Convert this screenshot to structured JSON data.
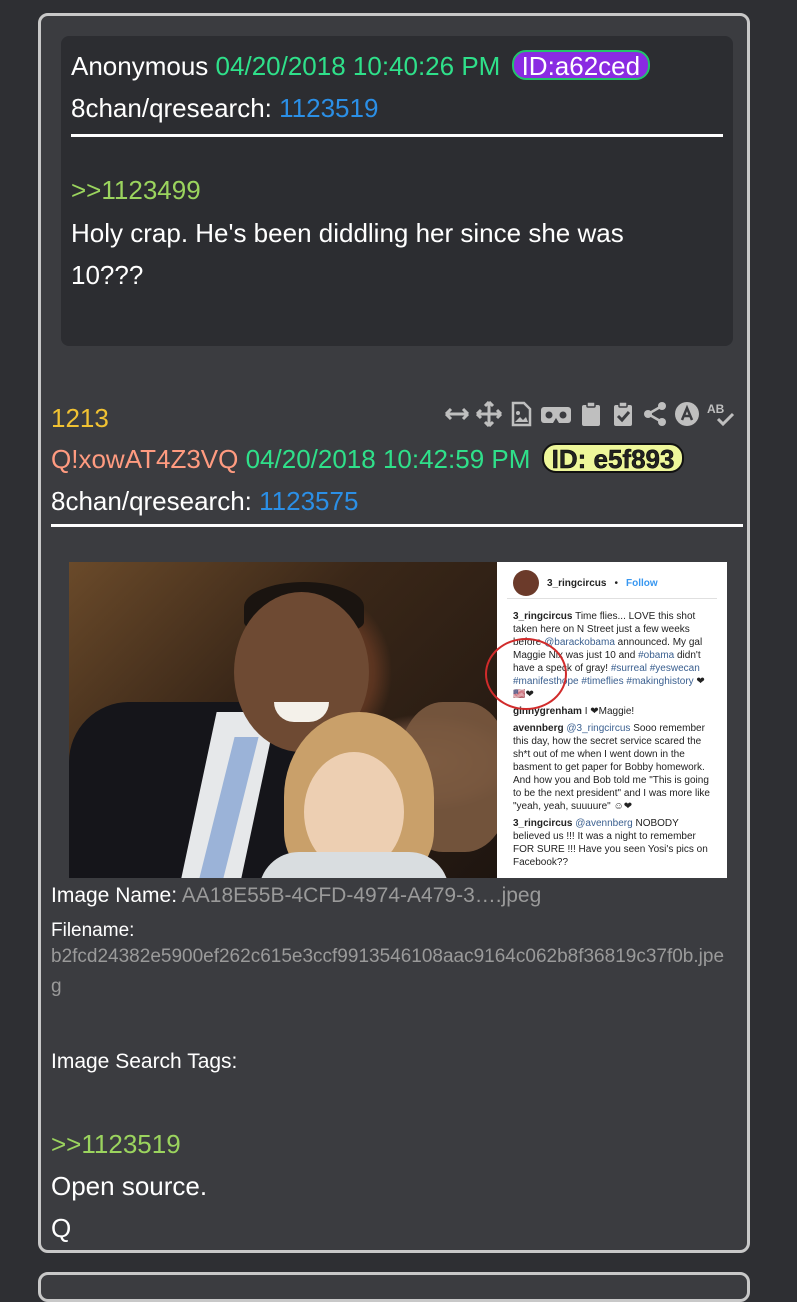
{
  "post1": {
    "author": "Anonymous",
    "datetime": "04/20/2018 10:40:26 PM",
    "id_badge": "ID:a62ced",
    "board": "8chan/qresearch:",
    "post_number": "1123519",
    "reply_link": ">>1123499",
    "body_line1": "Holy crap. He's been diddling her since she was",
    "body_line2": "10???"
  },
  "post2": {
    "index": "1213",
    "tripcode_prefix": "Q",
    "tripcode": "!xowAT4Z3VQ",
    "datetime": "04/20/2018 10:42:59 PM",
    "id_badge": "ID: e5f893",
    "board": "8chan/qresearch:",
    "post_number": "1123575",
    "image_name_label": "Image Name:",
    "image_name": "AA18E55B-4CFD-4974-A479-3….jpeg",
    "filename_label": "Filename:",
    "filename": "b2fcd24382e5900ef262c615e3ccf9913546108aac9164c062b8f36819c37f0b.jpeg",
    "search_tags_label": "Image Search Tags:",
    "reply_link": ">>1123519",
    "body_line1": "Open source.",
    "body_line2": "Q"
  },
  "toolbar_icons": [
    "arrows-horizontal-icon",
    "move-icon",
    "image-file-icon",
    "vr-icon",
    "clipboard-icon",
    "clipboard-check-icon",
    "share-icon",
    "text-a-icon",
    "spellcheck-icon"
  ],
  "instagram": {
    "username": "3_ringcircus",
    "follow": "Follow",
    "caption_user": "3_ringcircus",
    "caption": "Time flies... LOVE this shot taken here on N Street just a few weeks before",
    "mention": "@barackobama",
    "caption2": "announced. My gal Maggie Nix was just 10 and",
    "hashtag_obama": "#obama",
    "caption3": "didn't have a speck of gray!",
    "hashtags": "#surreal #yeswecan #manifesthope #timeflies #makinghistory",
    "c1_user": "ginnygrenham",
    "c1_text": "I ❤Maggie!",
    "c2_user": "avennberg",
    "c2_mention": "@3_ringcircus",
    "c2_text": "Sooo remember this day, how the secret service scared the sh*t out of me when I went down in the basment to get paper for Bobby homework. And how you and Bob told me \"This is going to be the next president\" and I was more like \"yeah, yeah, suuuure\" ☺❤",
    "c3_user": "3_ringcircus",
    "c3_mention": "@avennberg",
    "c3_text": "NOBODY believed us !!! It was a night to remember FOR SURE !!! Have you seen Yosi's pics on Facebook??"
  }
}
